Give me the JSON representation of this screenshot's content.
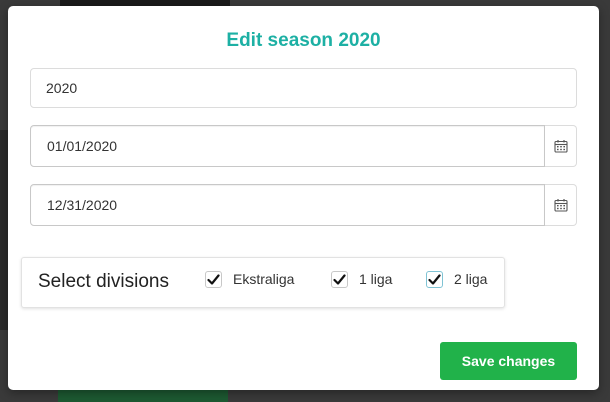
{
  "modal": {
    "title": "Edit season 2020"
  },
  "form": {
    "season_name": "2020",
    "start_date": "01/01/2020",
    "end_date": "12/31/2020"
  },
  "divisions": {
    "title": "Select divisions",
    "options": [
      {
        "label": "Ekstraliga",
        "checked": true
      },
      {
        "label": "1 liga",
        "checked": true
      },
      {
        "label": "2 liga",
        "checked": true
      }
    ]
  },
  "actions": {
    "save_label": "Save changes"
  },
  "colors": {
    "title": "#1db0a4",
    "save_button": "#21b24a",
    "backdrop": "#3a3a3a"
  },
  "icons": {
    "calendar": "calendar-icon",
    "check": "checkmark-icon"
  }
}
